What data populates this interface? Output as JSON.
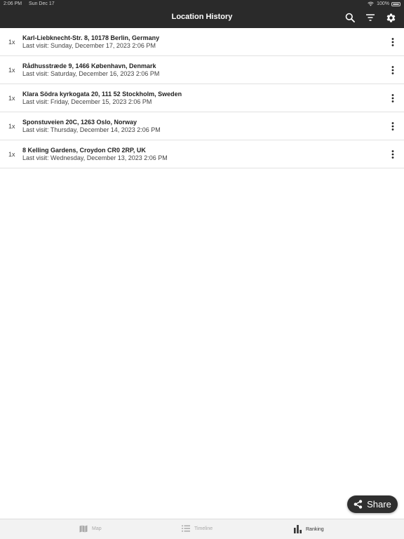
{
  "status_bar": {
    "time": "2:06 PM",
    "date": "Sun Dec 17",
    "battery": "100%"
  },
  "header": {
    "title": "Location History",
    "icons": [
      "search-icon",
      "filter-icon",
      "gear-icon"
    ]
  },
  "locations": [
    {
      "count": "1x",
      "address": "Karl-Liebknecht-Str. 8, 10178 Berlin, Germany",
      "last_visit": "Last visit: Sunday, December 17, 2023 2:06 PM"
    },
    {
      "count": "1x",
      "address": "Rådhusstræde 9, 1466 København, Denmark",
      "last_visit": "Last visit: Saturday, December 16, 2023 2:06 PM"
    },
    {
      "count": "1x",
      "address": "Klara Södra kyrkogata 20, 111 52 Stockholm, Sweden",
      "last_visit": "Last visit: Friday, December 15, 2023 2:06 PM"
    },
    {
      "count": "1x",
      "address": "Sponstuveien 20C, 1263 Oslo, Norway",
      "last_visit": "Last visit: Thursday, December 14, 2023 2:06 PM"
    },
    {
      "count": "1x",
      "address": "8 Kelling Gardens, Croydon CR0 2RP, UK",
      "last_visit": "Last visit: Wednesday, December 13, 2023 2:06 PM"
    }
  ],
  "share_button": {
    "label": "Share"
  },
  "tabs": [
    {
      "label": "Map",
      "icon": "map-icon",
      "active": false
    },
    {
      "label": "Timeline",
      "icon": "list-icon",
      "active": false
    },
    {
      "label": "Ranking",
      "icon": "bar-chart-icon",
      "active": true
    }
  ],
  "colors": {
    "header_bg": "#2a2a2a",
    "tab_bar_bg": "#f2f2f2",
    "inactive_tab": "#a9a9a9",
    "share_bg": "#2f2f2f"
  }
}
